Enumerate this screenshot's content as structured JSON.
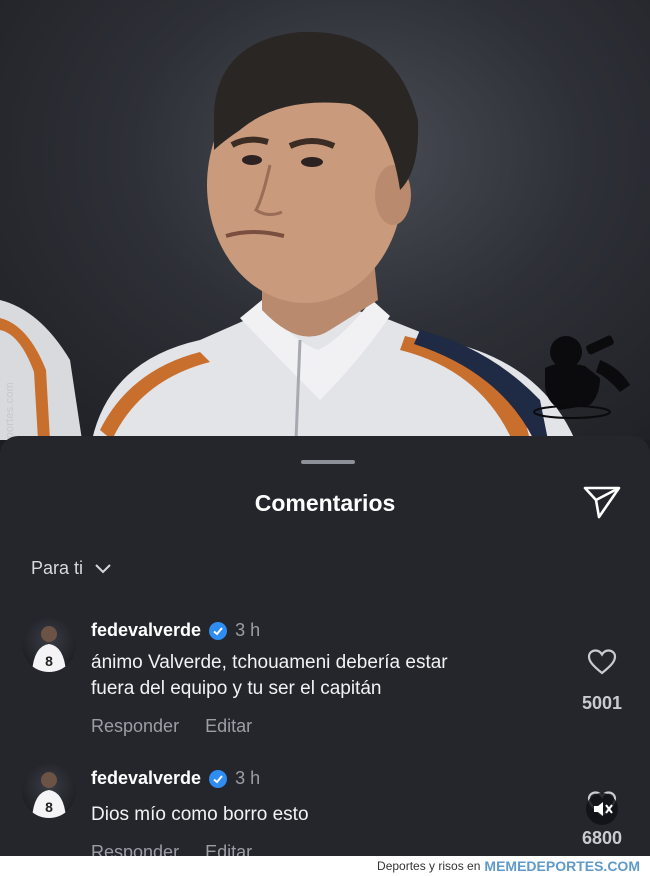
{
  "watermark_side": "Memedeportes.com",
  "sheet": {
    "title": "Comentarios",
    "filter_label": "Para ti"
  },
  "comments": [
    {
      "username": "fedevalverde",
      "time": "3 h",
      "text_lines": [
        "ánimo Valverde, tchouameni debería estar",
        "fuera del equipo y tu ser el capitán"
      ],
      "reply_label": "Responder",
      "edit_label": "Editar",
      "likes": "5001"
    },
    {
      "username": "fedevalverde",
      "time": "3 h",
      "text_lines": [
        "Dios mío como borro esto"
      ],
      "reply_label": "Responder",
      "edit_label": "Editar",
      "likes": "6800"
    }
  ],
  "footer": {
    "tagline": "Deportes y risos en",
    "brand": "MEMEDEPORTES.COM"
  },
  "colors": {
    "sheet_bg": "#25262c",
    "verified": "#2f8cf0",
    "muted_text": "#9c9ea6"
  }
}
